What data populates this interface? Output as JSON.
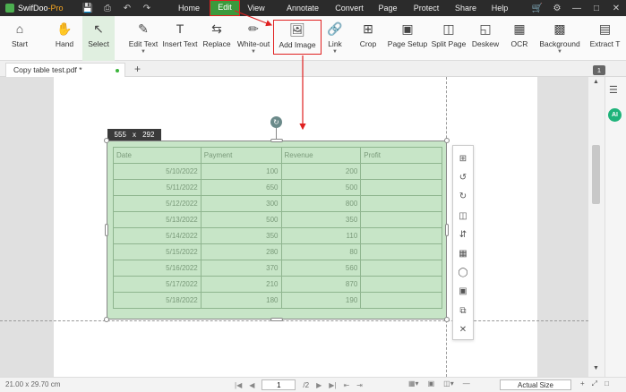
{
  "app": {
    "name": "SwifDoo",
    "edition": "-Pro"
  },
  "quick_access": [
    "save-icon",
    "print-icon",
    "undo-icon",
    "redo-icon"
  ],
  "menus": [
    {
      "label": "Home",
      "active": false
    },
    {
      "label": "Edit",
      "active": true
    },
    {
      "label": "View",
      "active": false
    },
    {
      "label": "Annotate",
      "active": false
    },
    {
      "label": "Convert",
      "active": false
    },
    {
      "label": "Page",
      "active": false
    },
    {
      "label": "Protect",
      "active": false
    },
    {
      "label": "Share",
      "active": false
    },
    {
      "label": "Help",
      "active": false
    }
  ],
  "ribbon": {
    "start": "Start",
    "hand": "Hand",
    "select": "Select",
    "edit_text": "Edit Text",
    "insert_text": "Insert Text",
    "replace": "Replace",
    "white_out": "White-out",
    "add_image": "Add Image",
    "link": "Link",
    "crop": "Crop",
    "page_setup": "Page Setup",
    "split_page": "Split Page",
    "deskew": "Deskew",
    "ocr": "OCR",
    "background": "Background",
    "extract": "Extract T"
  },
  "tab": {
    "title": "Copy table test.pdf *",
    "page_count_badge": "1"
  },
  "image": {
    "width": "555",
    "x": "x",
    "height": "292"
  },
  "table": {
    "headers": [
      "Date",
      "Payment",
      "Revenue",
      "Profit"
    ],
    "rows": [
      [
        "5/10/2022",
        "100",
        "200",
        ""
      ],
      [
        "5/11/2022",
        "650",
        "500",
        ""
      ],
      [
        "5/12/2022",
        "300",
        "800",
        ""
      ],
      [
        "5/13/2022",
        "500",
        "350",
        ""
      ],
      [
        "5/14/2022",
        "350",
        "110",
        ""
      ],
      [
        "5/15/2022",
        "280",
        "80",
        ""
      ],
      [
        "5/16/2022",
        "370",
        "560",
        ""
      ],
      [
        "5/17/2022",
        "210",
        "870",
        ""
      ],
      [
        "5/18/2022",
        "180",
        "190",
        ""
      ]
    ]
  },
  "status": {
    "dimensions": "21.00 x 29.70 cm",
    "page_current": "1",
    "page_total": "/2",
    "zoom": "Actual Size"
  },
  "side": {
    "ai_label": "AI"
  },
  "colors": {
    "accent": "#3c9a3c",
    "annotation": "#e02020",
    "image_fill": "#c7e5c7"
  }
}
